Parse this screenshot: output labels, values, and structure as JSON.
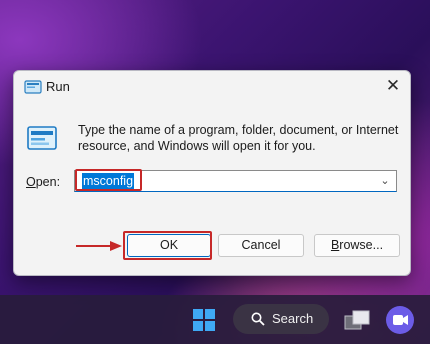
{
  "dialog": {
    "title": "Run",
    "description": "Type the name of a program, folder, document, or Internet resource, and Windows will open it for you.",
    "open_label_prefix": "O",
    "open_label_rest": "pen:",
    "input_value": "msconfig",
    "buttons": {
      "ok": "OK",
      "cancel": "Cancel",
      "browse_prefix": "B",
      "browse_rest": "rowse..."
    }
  },
  "taskbar": {
    "search_label": "Search"
  },
  "colors": {
    "accent": "#0067c0",
    "highlight": "#c62828"
  }
}
